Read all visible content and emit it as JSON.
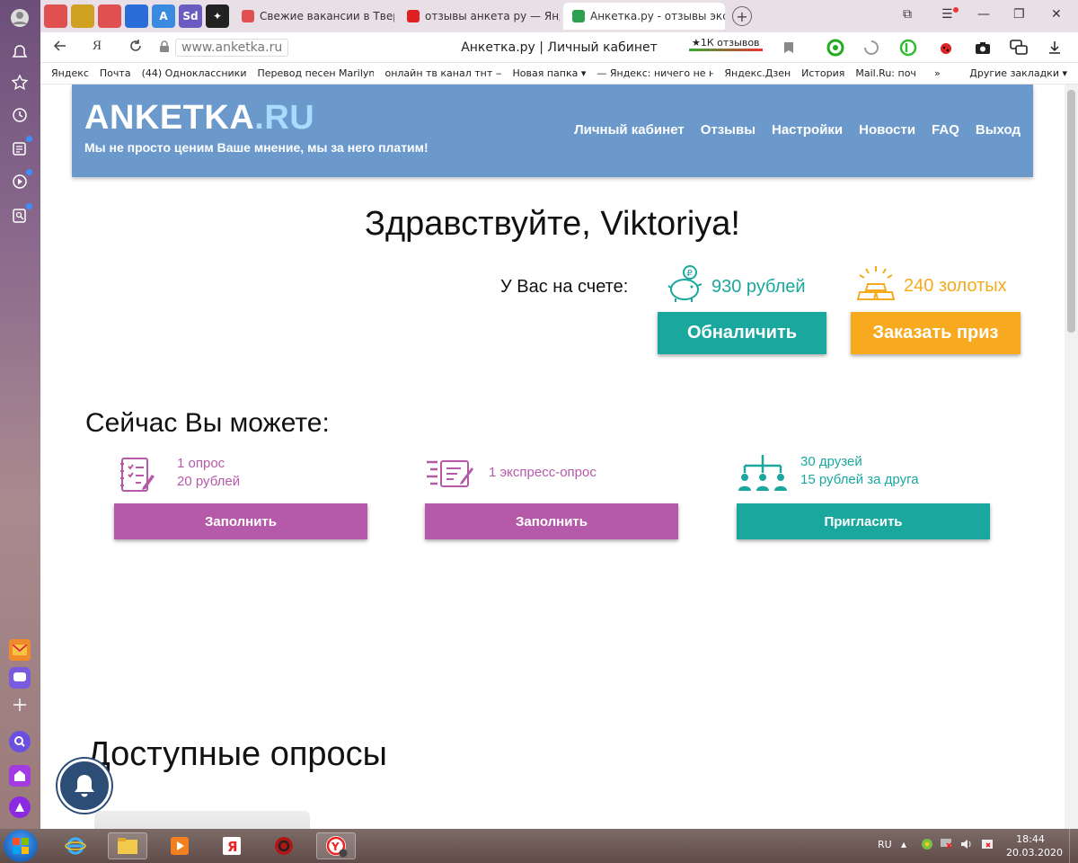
{
  "browser": {
    "pinned_tabs": [
      {
        "label": "",
        "color": "#e05050"
      },
      {
        "label": "",
        "color": "#d0a020"
      },
      {
        "label": "",
        "color": "#e05050"
      },
      {
        "label": "",
        "color": "#2a6cd8"
      },
      {
        "label": "A",
        "color": "#3a8be0"
      },
      {
        "label": "Sd",
        "color": "#6a5cc0"
      },
      {
        "label": "✦",
        "color": "#222222"
      }
    ],
    "tabs": [
      {
        "title": "Свежие вакансии в Твери",
        "favicon_color": "#e05050",
        "active": false
      },
      {
        "title": "отзывы анкета ру — Янде",
        "favicon_color": "#e02020",
        "active": false
      },
      {
        "title": "Анкетка.ру - отзывы эксп",
        "favicon_color": "#2aa050",
        "active": true
      }
    ],
    "url": "www.anketka.ru",
    "page_title": "Анкетка.ру | Личный кабинет",
    "reviews_badge": "★1К отзывов",
    "yandex_letter": "Я",
    "bookmarks": [
      "Яндекс",
      "Почта",
      "(44) Одноклассники",
      "Перевод песен Marilyn",
      "онлайн тв канал тнт —",
      "Новая папка ▾",
      "— Яндекс: ничего не н",
      "Яндекс.Дзен",
      "История",
      "Mail.Ru: поч"
    ],
    "bookmarks_more": "»",
    "bookmarks_other": "Другие закладки ▾"
  },
  "site": {
    "logo_main": "ANKETKA",
    "logo_suffix": ".RU",
    "tagline": "Мы не просто ценим Ваше мнение, мы за него платим!",
    "menu": [
      "Личный кабинет",
      "Отзывы",
      "Настройки",
      "Новости",
      "FAQ",
      "Выход"
    ],
    "greeting": "Здравствуйте, Viktoriya!",
    "balance_label": "У Вас на счете:",
    "rubles": "930 рублей",
    "gold": "240 золотых",
    "cashout_label": "Обналичить",
    "prize_label": "Заказать приз",
    "now_title": "Сейчас Вы можете:",
    "cards": [
      {
        "line1": "1 опрос",
        "line2": "20 рублей",
        "button": "Заполнить"
      },
      {
        "line1": "1 экспресс-опрос",
        "line2": "",
        "button": "Заполнить"
      },
      {
        "line1": "30 друзей",
        "line2": "15 рублей за друга",
        "button": "Пригласить"
      }
    ],
    "available_title": "Доступные опросы",
    "colors": {
      "header": "#6b99cc",
      "teal": "#1aa89e",
      "orange": "#f8aa1e",
      "pink": "#b55aa8"
    }
  },
  "taskbar": {
    "lang": "RU",
    "time": "18:44",
    "date": "20.03.2020",
    "yandex_letter": "Я"
  }
}
